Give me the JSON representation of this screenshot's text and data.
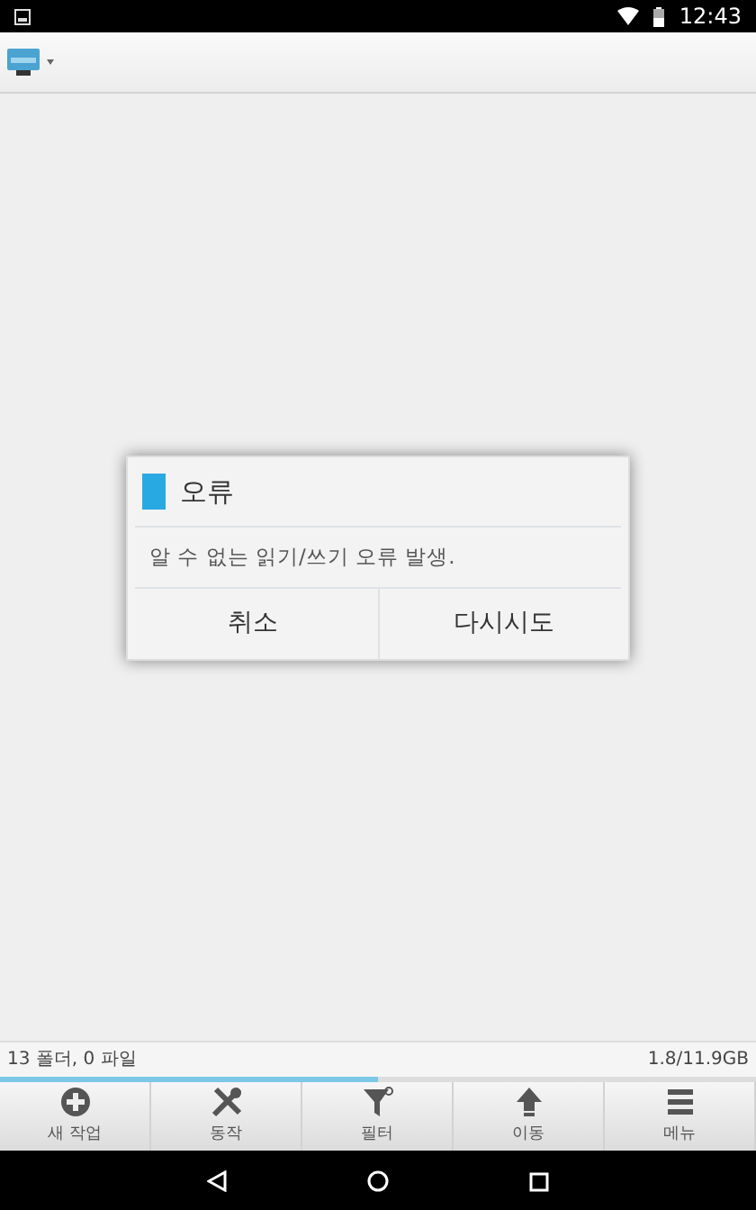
{
  "status_bar": {
    "time": "12:43"
  },
  "dialog": {
    "title": "오류",
    "message": "알 수 없는 읽기/쓰기 오류 발생.",
    "buttons": [
      "취소",
      "다시시도"
    ]
  },
  "info_bar": {
    "left": "13 폴더, 0 파일",
    "right": "1.8/11.9GB",
    "level": 0.5
  },
  "bottom_toolbar": [
    {
      "kind": "add",
      "label": "새 작업"
    },
    {
      "kind": "tools",
      "label": "동작"
    },
    {
      "kind": "filter",
      "label": "필터"
    },
    {
      "kind": "up",
      "label": "이동"
    },
    {
      "kind": "menu",
      "label": "메뉴"
    }
  ]
}
